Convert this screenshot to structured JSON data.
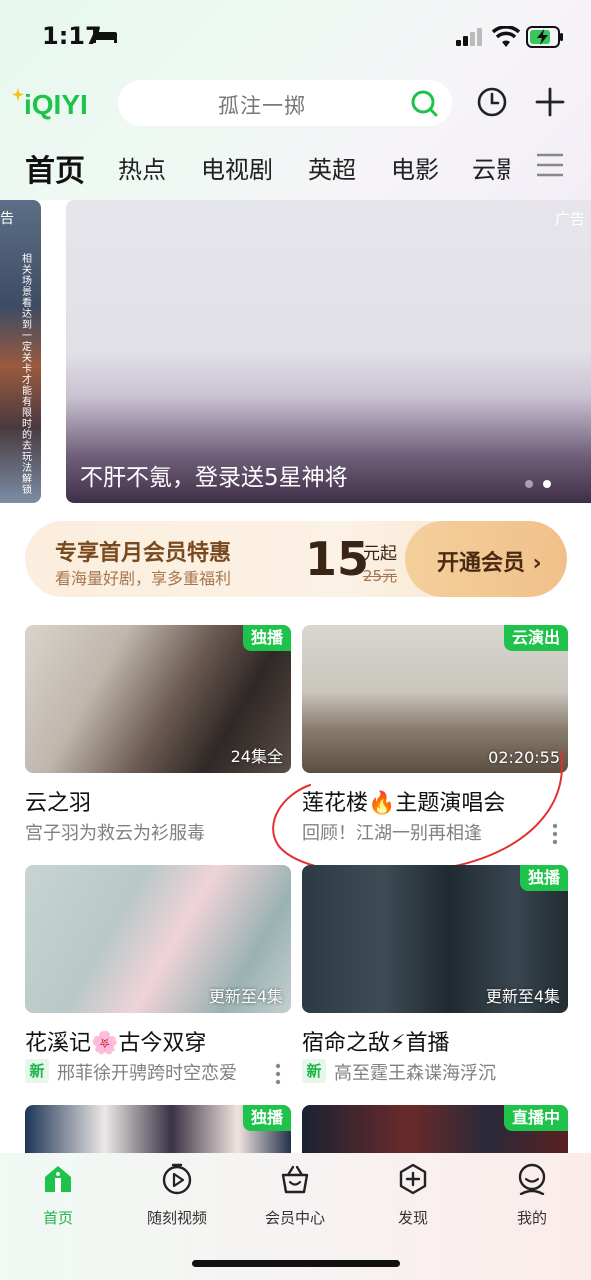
{
  "status_bar": {
    "time": "1:17"
  },
  "header": {
    "logo": "iQIYI",
    "search_placeholder": "孤注一掷"
  },
  "tabs": [
    {
      "label": "首页"
    },
    {
      "label": "热点"
    },
    {
      "label": "电视剧"
    },
    {
      "label": "英超"
    },
    {
      "label": "电影"
    },
    {
      "label": "云影"
    }
  ],
  "banner": {
    "left_ad_label": "告",
    "left_ad_text": "相关场景看达到一定关卡才能有限时的去玩法解锁",
    "ad_label": "广告",
    "caption": "不肝不氪，登录送5星神将"
  },
  "vip": {
    "title": "专享首月会员特惠",
    "subtitle": "看海量好剧，享多重福利",
    "price": "15",
    "unit": "元起",
    "old_price": "25元",
    "button_label": "开通会员 ›"
  },
  "cards": [
    {
      "badge": "独播",
      "corner": "24集全",
      "title": "云之羽",
      "subtitle": "宫子羽为救云为衫服毒",
      "new": false
    },
    {
      "badge": "云演出",
      "corner": "02:20:55",
      "title": "莲花楼🔥主题演唱会",
      "subtitle": "回顾！江湖一别再相逢",
      "new": false
    },
    {
      "badge": "",
      "corner": "更新至4集",
      "title": "花溪记🌸古今双穿",
      "subtitle": "邢菲徐开骋跨时空恋爱",
      "new": true,
      "new_label": "新"
    },
    {
      "badge": "独播",
      "corner": "更新至4集",
      "title": "宿命之敌⚡首播",
      "subtitle": "高至霆王森谍海浮沉",
      "new": true,
      "new_label": "新"
    },
    {
      "badge": "独播",
      "corner": "",
      "title": "",
      "subtitle": "",
      "new": false
    },
    {
      "badge": "直播中",
      "corner": "",
      "title": "",
      "subtitle": "",
      "new": false
    }
  ],
  "bottom_nav": [
    {
      "label": "首页",
      "icon": "home-icon",
      "active": true
    },
    {
      "label": "随刻视频",
      "icon": "play-icon",
      "active": false
    },
    {
      "label": "会员中心",
      "icon": "vip-basket-icon",
      "active": false
    },
    {
      "label": "发现",
      "icon": "discover-plus-icon",
      "active": false
    },
    {
      "label": "我的",
      "icon": "profile-icon",
      "active": false
    }
  ],
  "colors": {
    "brand_green": "#1fc24b",
    "vip_gold": "#f1c08a",
    "annotation_red": "#e0312f"
  }
}
